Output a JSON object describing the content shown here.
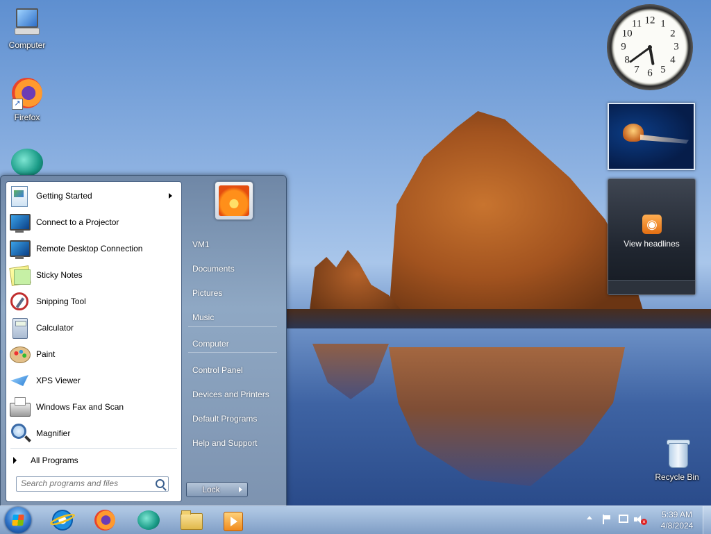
{
  "desktop": {
    "icons": [
      {
        "label": "Computer"
      },
      {
        "label": "Firefox"
      },
      {
        "label": ""
      },
      {
        "label": "Recycle Bin"
      }
    ]
  },
  "gadgets": {
    "clock": {
      "numbers": [
        "12",
        "1",
        "2",
        "3",
        "4",
        "5",
        "6",
        "7",
        "8",
        "9",
        "10",
        "11"
      ],
      "hour": 5,
      "minute": 39
    },
    "feeds": {
      "label": "View headlines",
      "icon": "rss-icon"
    }
  },
  "start_menu": {
    "programs": [
      {
        "label": "Getting Started",
        "has_submenu": true
      },
      {
        "label": "Connect to a Projector"
      },
      {
        "label": "Remote Desktop Connection"
      },
      {
        "label": "Sticky Notes"
      },
      {
        "label": "Snipping Tool"
      },
      {
        "label": "Calculator"
      },
      {
        "label": "Paint"
      },
      {
        "label": "XPS Viewer"
      },
      {
        "label": "Windows Fax and Scan"
      },
      {
        "label": "Magnifier"
      }
    ],
    "all_programs": "All Programs",
    "search_placeholder": "Search programs and files",
    "right_links": [
      "VM1",
      "Documents",
      "Pictures",
      "Music",
      "Computer",
      "Control Panel",
      "Devices and Printers",
      "Default Programs",
      "Help and Support"
    ],
    "lock_label": "Lock"
  },
  "taskbar": {
    "pinned": [
      "internet-explorer-icon",
      "firefox-icon",
      "teal-app-icon",
      "windows-explorer-icon",
      "media-player-icon"
    ],
    "time": "5:39 AM",
    "date": "4/8/2024"
  }
}
